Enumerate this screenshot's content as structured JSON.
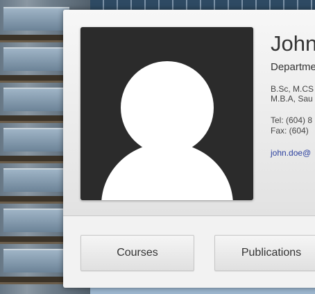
{
  "profile": {
    "name": "John",
    "department": "Departme",
    "degrees_line1": "B.Sc, M.CS",
    "degrees_line2": "M.B.A, Sau",
    "tel": "Tel: (604) 8",
    "fax": "Fax: (604)",
    "email": "john.doe@"
  },
  "buttons": {
    "courses": "Courses",
    "publications": "Publications"
  },
  "colors": {
    "link": "#2a3f9e",
    "photo_bg": "#2b2b2b"
  }
}
